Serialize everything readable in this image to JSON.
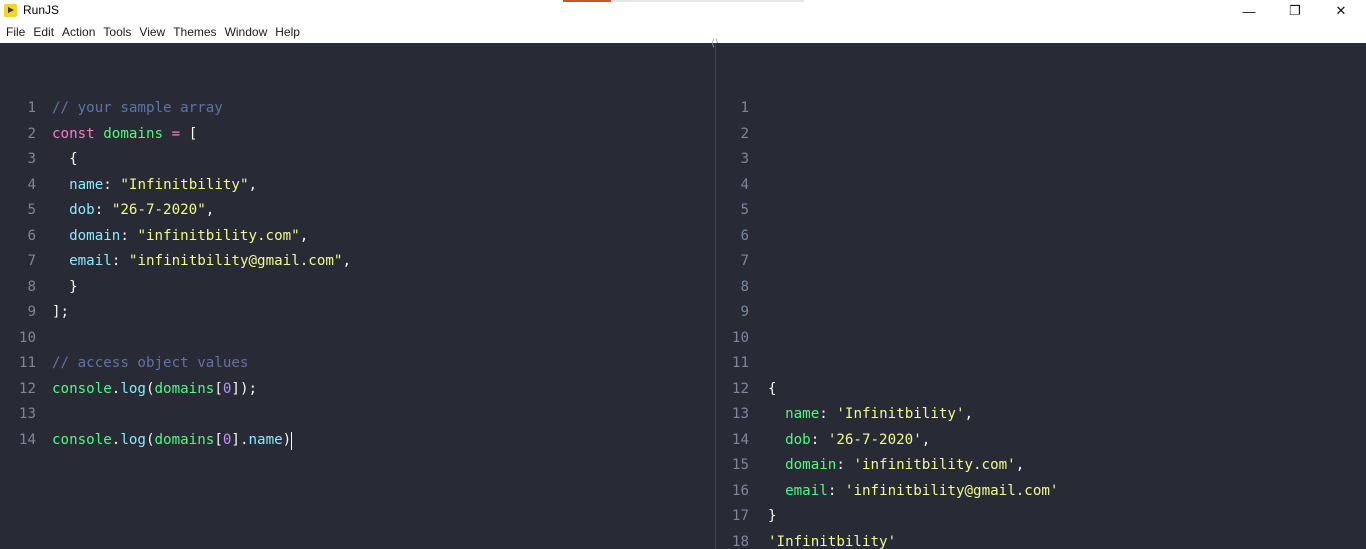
{
  "window": {
    "title": "RunJS",
    "icon": "runjs-logo-icon",
    "controls": {
      "minimize": "—",
      "maximize": "❐",
      "close": "✕"
    },
    "progress_fraction": 0.2,
    "progress_color": "#c8562a"
  },
  "menubar": {
    "items": [
      "File",
      "Edit",
      "Action",
      "Tools",
      "View",
      "Themes",
      "Window",
      "Help"
    ]
  },
  "editor": {
    "lines": [
      {
        "n": "1",
        "tokens": [
          {
            "t": "// your sample array",
            "c": "comment"
          }
        ]
      },
      {
        "n": "2",
        "tokens": [
          {
            "t": "const",
            "c": "keyword"
          },
          {
            "t": " ",
            "c": "punct"
          },
          {
            "t": "domains",
            "c": "var"
          },
          {
            "t": " ",
            "c": "punct"
          },
          {
            "t": "=",
            "c": "op"
          },
          {
            "t": " [",
            "c": "punct"
          }
        ]
      },
      {
        "n": "3",
        "tokens": [
          {
            "t": "  {",
            "c": "punct"
          }
        ]
      },
      {
        "n": "4",
        "tokens": [
          {
            "t": "  ",
            "c": "punct"
          },
          {
            "t": "name",
            "c": "prop"
          },
          {
            "t": ": ",
            "c": "punct"
          },
          {
            "t": "\"Infinitbility\"",
            "c": "string"
          },
          {
            "t": ",",
            "c": "punct"
          }
        ]
      },
      {
        "n": "5",
        "tokens": [
          {
            "t": "  ",
            "c": "punct"
          },
          {
            "t": "dob",
            "c": "prop"
          },
          {
            "t": ": ",
            "c": "punct"
          },
          {
            "t": "\"26-7-2020\"",
            "c": "string"
          },
          {
            "t": ",",
            "c": "punct"
          }
        ]
      },
      {
        "n": "6",
        "tokens": [
          {
            "t": "  ",
            "c": "punct"
          },
          {
            "t": "domain",
            "c": "prop"
          },
          {
            "t": ": ",
            "c": "punct"
          },
          {
            "t": "\"infinitbility.com\"",
            "c": "string"
          },
          {
            "t": ",",
            "c": "punct"
          }
        ]
      },
      {
        "n": "7",
        "tokens": [
          {
            "t": "  ",
            "c": "punct"
          },
          {
            "t": "email",
            "c": "prop"
          },
          {
            "t": ": ",
            "c": "punct"
          },
          {
            "t": "\"infinitbility@gmail.com\"",
            "c": "string"
          },
          {
            "t": ",",
            "c": "punct"
          }
        ]
      },
      {
        "n": "8",
        "tokens": [
          {
            "t": "  }",
            "c": "punct"
          }
        ]
      },
      {
        "n": "9",
        "tokens": [
          {
            "t": "];",
            "c": "punct"
          }
        ]
      },
      {
        "n": "10",
        "tokens": []
      },
      {
        "n": "11",
        "tokens": [
          {
            "t": "// access object values",
            "c": "comment"
          }
        ]
      },
      {
        "n": "12",
        "tokens": [
          {
            "t": "console",
            "c": "var"
          },
          {
            "t": ".",
            "c": "punct"
          },
          {
            "t": "log",
            "c": "fn"
          },
          {
            "t": "(",
            "c": "punct"
          },
          {
            "t": "domains",
            "c": "var"
          },
          {
            "t": "[",
            "c": "punct"
          },
          {
            "t": "0",
            "c": "num"
          },
          {
            "t": "]);",
            "c": "punct"
          }
        ]
      },
      {
        "n": "13",
        "tokens": []
      },
      {
        "n": "14",
        "tokens": [
          {
            "t": "console",
            "c": "var"
          },
          {
            "t": ".",
            "c": "punct"
          },
          {
            "t": "log",
            "c": "fn"
          },
          {
            "t": "(",
            "c": "punct"
          },
          {
            "t": "domains",
            "c": "var"
          },
          {
            "t": "[",
            "c": "punct"
          },
          {
            "t": "0",
            "c": "num"
          },
          {
            "t": "].",
            "c": "punct"
          },
          {
            "t": "name",
            "c": "prop"
          },
          {
            "t": ")",
            "c": "punct"
          }
        ],
        "cursor": true
      }
    ]
  },
  "output": {
    "add_tab_icon": "+",
    "lines": [
      {
        "n": "1",
        "tokens": []
      },
      {
        "n": "2",
        "tokens": []
      },
      {
        "n": "3",
        "tokens": []
      },
      {
        "n": "4",
        "tokens": []
      },
      {
        "n": "5",
        "tokens": []
      },
      {
        "n": "6",
        "tokens": []
      },
      {
        "n": "7",
        "tokens": []
      },
      {
        "n": "8",
        "tokens": []
      },
      {
        "n": "9",
        "tokens": []
      },
      {
        "n": "10",
        "tokens": []
      },
      {
        "n": "11",
        "tokens": []
      },
      {
        "n": "12",
        "tokens": [
          {
            "t": "{",
            "c": "punct"
          }
        ]
      },
      {
        "n": "13",
        "tokens": [
          {
            "t": "  ",
            "c": "punct"
          },
          {
            "t": "name",
            "c": "okey"
          },
          {
            "t": ": ",
            "c": "punct"
          },
          {
            "t": "'Infinitbility'",
            "c": "string"
          },
          {
            "t": ",",
            "c": "punct"
          }
        ]
      },
      {
        "n": "14",
        "tokens": [
          {
            "t": "  ",
            "c": "punct"
          },
          {
            "t": "dob",
            "c": "okey"
          },
          {
            "t": ": ",
            "c": "punct"
          },
          {
            "t": "'26-7-2020'",
            "c": "string"
          },
          {
            "t": ",",
            "c": "punct"
          }
        ]
      },
      {
        "n": "15",
        "tokens": [
          {
            "t": "  ",
            "c": "punct"
          },
          {
            "t": "domain",
            "c": "okey"
          },
          {
            "t": ": ",
            "c": "punct"
          },
          {
            "t": "'infinitbility.com'",
            "c": "string"
          },
          {
            "t": ",",
            "c": "punct"
          }
        ]
      },
      {
        "n": "16",
        "tokens": [
          {
            "t": "  ",
            "c": "punct"
          },
          {
            "t": "email",
            "c": "okey"
          },
          {
            "t": ": ",
            "c": "punct"
          },
          {
            "t": "'infinitbility@gmail.com'",
            "c": "string"
          }
        ]
      },
      {
        "n": "17",
        "tokens": [
          {
            "t": "}",
            "c": "punct"
          }
        ]
      },
      {
        "n": "18",
        "tokens": [
          {
            "t": "'Infinitbility'",
            "c": "string"
          }
        ]
      }
    ]
  },
  "theme_colors": {
    "background": "#282a36",
    "comment": "#6272a4",
    "keyword": "#ff79c6",
    "variable": "#50fa7b",
    "property": "#8be9fd",
    "string": "#f1fa8c",
    "number": "#bd93f9",
    "text": "#f8f8f2"
  }
}
